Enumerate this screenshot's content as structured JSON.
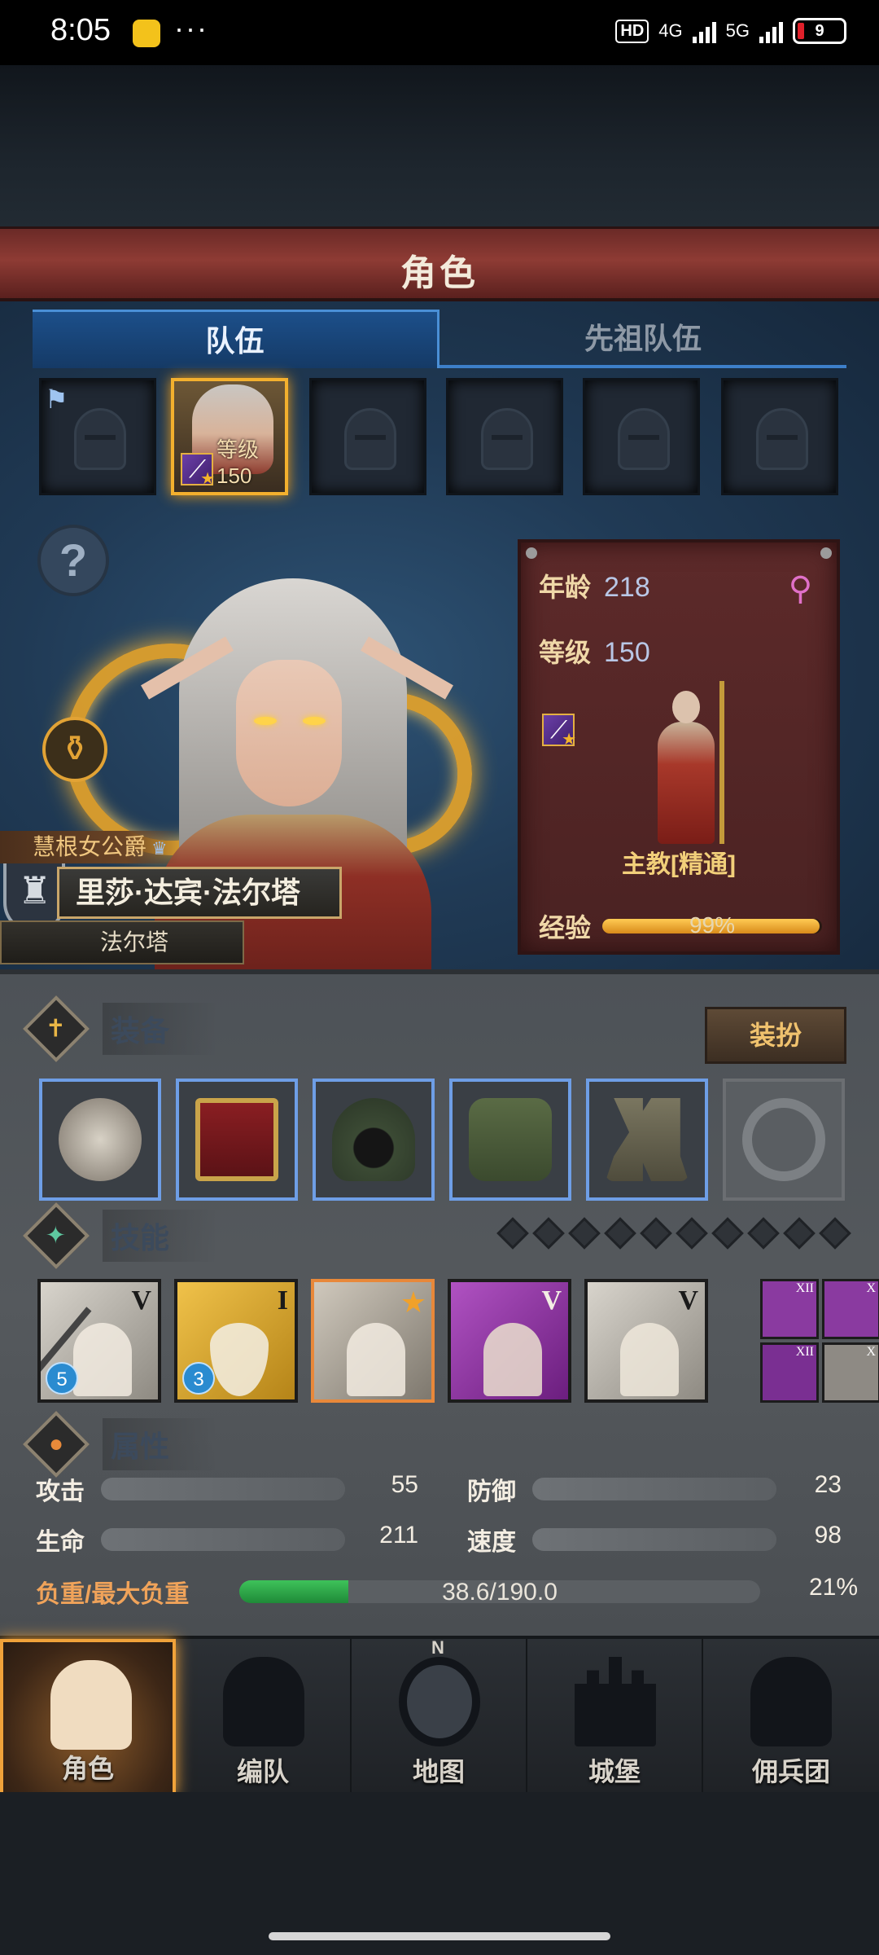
{
  "status_bar": {
    "time": "8:05",
    "dots": "···",
    "hd": "HD",
    "net1": "4G",
    "net2": "5G",
    "battery": "9"
  },
  "header": {
    "title": "角色"
  },
  "tabs": [
    {
      "label": "队伍",
      "active": true
    },
    {
      "label": "先祖队伍",
      "active": false
    }
  ],
  "team_slots": {
    "selected_level_label": "等级150"
  },
  "hero": {
    "title": "慧根女公爵",
    "name": "里莎·达宾·法尔塔",
    "house": "法尔塔"
  },
  "info_card": {
    "age_label": "年龄",
    "age_value": "218",
    "level_label": "等级",
    "level_value": "150",
    "class_name": "主教[精通]",
    "exp_label": "经验",
    "exp_percent": "99%",
    "exp_fraction": 0.99
  },
  "equipment": {
    "title": "装备",
    "dress_button": "装扮"
  },
  "skills": {
    "title": "技能",
    "items": [
      {
        "numeral": "V",
        "badge": "5"
      },
      {
        "numeral": "I",
        "badge": "3"
      },
      {
        "numeral": "",
        "badge": ""
      },
      {
        "numeral": "V",
        "badge": ""
      },
      {
        "numeral": "V",
        "badge": ""
      }
    ],
    "mini": [
      "XII",
      "X",
      "XII",
      "X"
    ]
  },
  "attributes": {
    "title": "属性",
    "attack_label": "攻击",
    "attack_value": "55",
    "defense_label": "防御",
    "defense_value": "23",
    "life_label": "生命",
    "life_value": "211",
    "speed_label": "速度",
    "speed_value": "98",
    "load_label": "负重/最大负重",
    "load_value": "38.6/190.0",
    "load_percent": "21%",
    "load_fraction": 0.21
  },
  "nav": [
    {
      "label": "角色",
      "icon": "knight-icon",
      "active": true
    },
    {
      "label": "编队",
      "icon": "helmet-icon",
      "active": false
    },
    {
      "label": "地图",
      "icon": "compass-icon",
      "active": false
    },
    {
      "label": "城堡",
      "icon": "castle-icon",
      "active": false
    },
    {
      "label": "佣兵团",
      "icon": "fist-icon",
      "active": false
    }
  ],
  "colors": {
    "accent_gold": "#f0a23a",
    "tab_blue": "#1c4f8a",
    "header_red": "#8e3b34",
    "load_green": "#3ec25a"
  }
}
